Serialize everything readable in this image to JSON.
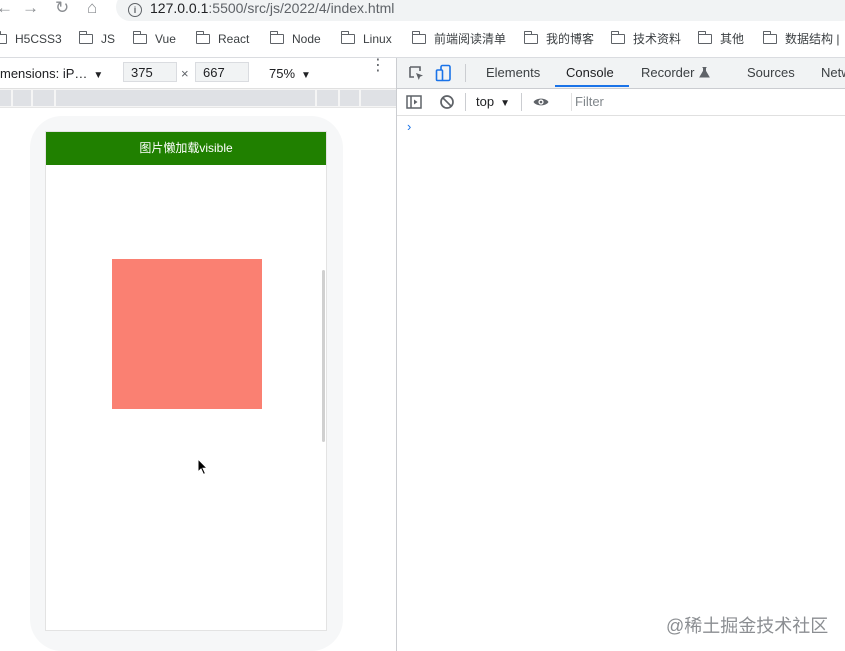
{
  "browser": {
    "nav_back": "←",
    "nav_forward": "→",
    "nav_reload": "↻",
    "nav_home": "⌂",
    "url_host": "127.0.0.1",
    "url_path": ":5500/src/js/2022/4/index.html"
  },
  "bookmarks": [
    {
      "label": "H5CSS3"
    },
    {
      "label": "JS"
    },
    {
      "label": "Vue"
    },
    {
      "label": "React"
    },
    {
      "label": "Node"
    },
    {
      "label": "Linux"
    },
    {
      "label": "前端阅读清单"
    },
    {
      "label": "我的博客"
    },
    {
      "label": "技术资料"
    },
    {
      "label": "其他"
    },
    {
      "label": "数据结构 |"
    }
  ],
  "emulation": {
    "dimensions_label": "mensions: iP…",
    "caret": "▼",
    "width": "375",
    "times": "×",
    "height": "667",
    "zoom": "75%",
    "more": "⋮"
  },
  "page": {
    "header_title": "图片懒加载visible",
    "box_color": "#fa8072",
    "header_color": "#208000"
  },
  "devtools": {
    "tabs": [
      "Elements",
      "Console",
      "Recorder",
      "Sources",
      "Netw"
    ],
    "active_tab": "Console",
    "context": "top",
    "context_caret": "▼",
    "filter_placeholder": "Filter",
    "prompt": "›"
  },
  "watermark": "@稀土掘金技术社区"
}
